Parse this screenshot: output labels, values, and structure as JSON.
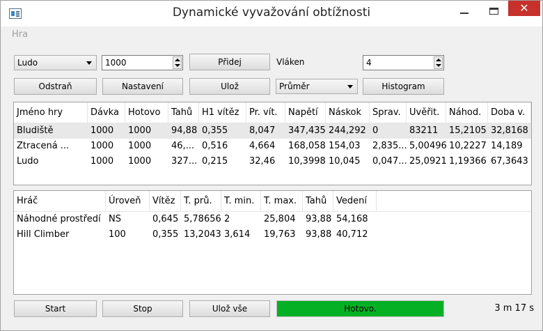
{
  "window": {
    "title": "Dynamické vyvažování obtížnosti"
  },
  "menu": {
    "items": [
      "Hra"
    ]
  },
  "controls": {
    "game_combo": "Ludo",
    "batch_value": "1000",
    "add_label": "Přidej",
    "threads_label": "Vláken",
    "threads_value": "4",
    "remove_label": "Odstraň",
    "settings_label": "Nastavení",
    "save_label": "Ulož",
    "stat_combo": "Průměr",
    "histogram_label": "Histogram"
  },
  "games_table": {
    "headers": [
      "Jméno hry",
      "Dávka",
      "Hotovo",
      "Tahů",
      "H1 vítěz",
      "Pr. vít.",
      "Napětí",
      "Náskok",
      "Sprav.",
      "Uvěřit.",
      "Náhod.",
      "Doba v."
    ],
    "rows": [
      [
        "Bludiště",
        "1000",
        "1000",
        "94,88",
        "0,355",
        "8,047",
        "347,435",
        "244,292",
        "0",
        "83211",
        "15,2105",
        "32,8168"
      ],
      [
        "Ztracená ...",
        "1000",
        "1000",
        "46,...",
        "0,516",
        "4,664",
        "168,058",
        "154,03",
        "2,835...",
        "5,00496",
        "10,2227",
        "14,189"
      ],
      [
        "Ludo",
        "1000",
        "1000",
        "327...",
        "0,215",
        "32,46",
        "10,3998",
        "10,045",
        "0,047...",
        "25,0921",
        "1,19366",
        "67,3643"
      ]
    ]
  },
  "players_table": {
    "headers": [
      "Hráč",
      "Úroveň",
      "Vítěz",
      "T. prů.",
      "T. min.",
      "T. max.",
      "Tahů",
      "Vedení"
    ],
    "rows": [
      [
        "Náhodné prostředí",
        "NS",
        "0,645",
        "5,78656",
        "2",
        "25,804",
        "93,88",
        "54,168"
      ],
      [
        "Hill Climber",
        "100",
        "0,355",
        "13,2043",
        "3,614",
        "19,763",
        "93,88",
        "40,712"
      ]
    ]
  },
  "footer": {
    "start_label": "Start",
    "stop_label": "Stop",
    "save_all_label": "Ulož vše",
    "progress_text": "Hotovo.",
    "progress_value": 1.0,
    "elapsed": "3 m 17 s"
  },
  "colors": {
    "progress": "#06b025",
    "close": "#c7312b"
  },
  "icons": [
    "app-icon",
    "minimize-icon",
    "maximize-icon",
    "close-icon",
    "dropdown-arrow-icon",
    "spin-arrows-icon"
  ]
}
